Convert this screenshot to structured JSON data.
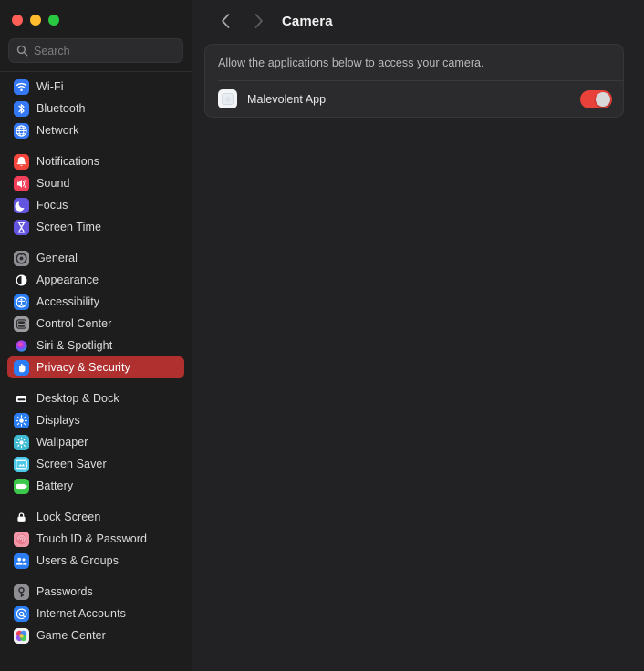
{
  "window": {
    "traffic_lights": [
      {
        "name": "close-button",
        "color": "#ff5f57"
      },
      {
        "name": "minimize-button",
        "color": "#febc2e"
      },
      {
        "name": "maximize-button",
        "color": "#28c840"
      }
    ]
  },
  "search": {
    "placeholder": "Search",
    "value": "",
    "icon": "search-icon"
  },
  "sidebar": {
    "groups": [
      {
        "items": [
          {
            "label": "Wi-Fi",
            "icon": "wifi-icon",
            "icon_bg": "#3478f6",
            "selected": false
          },
          {
            "label": "Bluetooth",
            "icon": "bluetooth-icon",
            "icon_bg": "#3478f6",
            "selected": false
          },
          {
            "label": "Network",
            "icon": "network-globe-icon",
            "icon_bg": "#3478f6",
            "selected": false
          }
        ]
      },
      {
        "items": [
          {
            "label": "Notifications",
            "icon": "bell-icon",
            "icon_bg": "#f4463c",
            "selected": false
          },
          {
            "label": "Sound",
            "icon": "speaker-icon",
            "icon_bg": "#f2405a",
            "selected": false
          },
          {
            "label": "Focus",
            "icon": "moon-icon",
            "icon_bg": "#6355e0",
            "selected": false
          },
          {
            "label": "Screen Time",
            "icon": "hourglass-icon",
            "icon_bg": "#6355e0",
            "selected": false
          }
        ]
      },
      {
        "items": [
          {
            "label": "General",
            "icon": "gear-icon",
            "icon_bg": "#8e8e93",
            "selected": false
          },
          {
            "label": "Appearance",
            "icon": "contrast-circle-icon",
            "icon_bg": "#1c1c1e",
            "selected": false
          },
          {
            "label": "Accessibility",
            "icon": "accessibility-icon",
            "icon_bg": "#2a7df5",
            "selected": false
          },
          {
            "label": "Control Center",
            "icon": "control-center-icon",
            "icon_bg": "#9a9a9f",
            "selected": false
          },
          {
            "label": "Siri & Spotlight",
            "icon": "siri-orb-icon",
            "icon_bg": "#1c1c1e",
            "selected": false
          },
          {
            "label": "Privacy & Security",
            "icon": "privacy-hand-icon",
            "icon_bg": "#2a7df5",
            "selected": true
          }
        ]
      },
      {
        "items": [
          {
            "label": "Desktop & Dock",
            "icon": "desktop-dock-icon",
            "icon_bg": "#1c1c1e",
            "selected": false
          },
          {
            "label": "Displays",
            "icon": "display-sun-icon",
            "icon_bg": "#2a7df5",
            "selected": false
          },
          {
            "label": "Wallpaper",
            "icon": "wallpaper-icon",
            "icon_bg": "#3fbcd4",
            "selected": false
          },
          {
            "label": "Screen Saver",
            "icon": "screen-saver-icon",
            "icon_bg": "#4cc8e8",
            "selected": false
          },
          {
            "label": "Battery",
            "icon": "battery-icon",
            "icon_bg": "#3cc84a",
            "selected": false
          }
        ]
      },
      {
        "items": [
          {
            "label": "Lock Screen",
            "icon": "lock-icon",
            "icon_bg": "#1c1c1e",
            "selected": false
          },
          {
            "label": "Touch ID & Password",
            "icon": "fingerprint-icon",
            "icon_bg": "#f297a8",
            "selected": false
          },
          {
            "label": "Users & Groups",
            "icon": "users-icon",
            "icon_bg": "#2a7df5",
            "selected": false
          }
        ]
      },
      {
        "items": [
          {
            "label": "Passwords",
            "icon": "key-icon",
            "icon_bg": "#8e8e93",
            "selected": false
          },
          {
            "label": "Internet Accounts",
            "icon": "at-sign-icon",
            "icon_bg": "#2a7df5",
            "selected": false
          },
          {
            "label": "Game Center",
            "icon": "game-center-icon",
            "icon_bg": "#f2f2f2",
            "selected": false
          }
        ]
      }
    ]
  },
  "toolbar": {
    "back_icon": "chevron-left-icon",
    "forward_icon": "chevron-right-icon",
    "back_enabled": true,
    "forward_enabled": false,
    "title": "Camera"
  },
  "panel": {
    "description": "Allow the applications below to access your camera.",
    "apps": [
      {
        "name": "Malevolent App",
        "icon": "generic-app-icon",
        "toggle_on": true,
        "toggle_color": "#e8423a"
      }
    ]
  }
}
